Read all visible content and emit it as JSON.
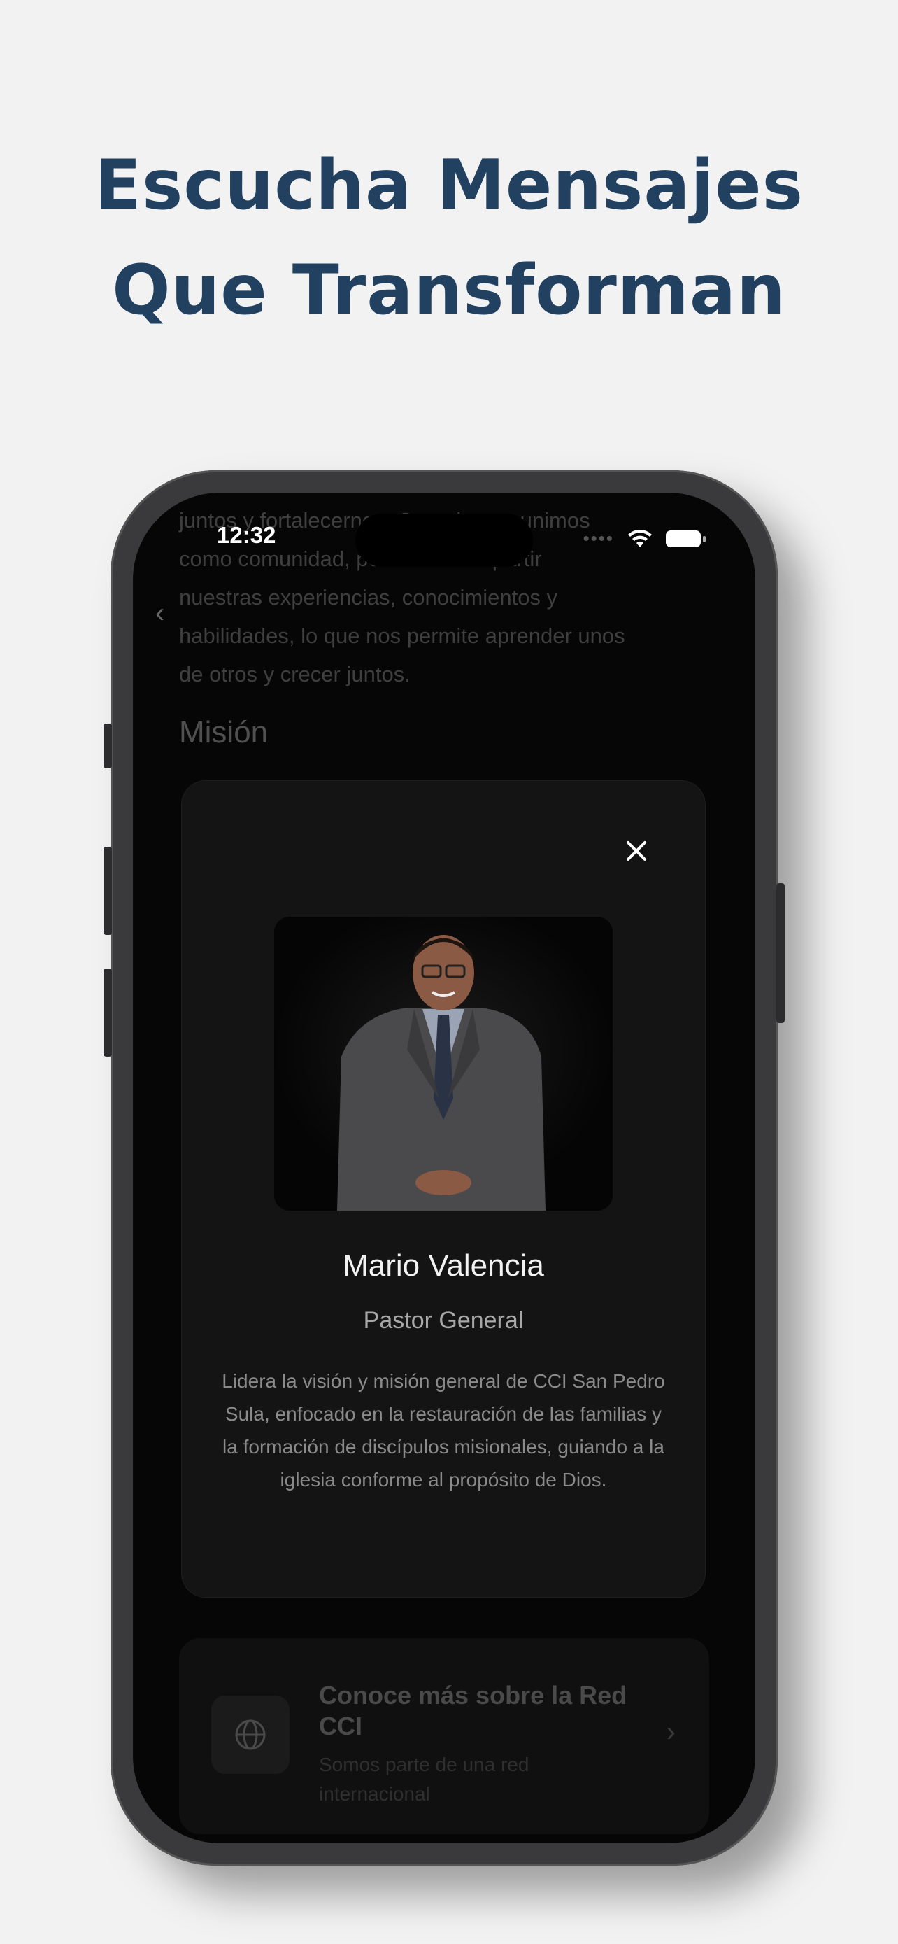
{
  "headline": {
    "line1": "Escucha Mensajes",
    "line2": "Que Transforman"
  },
  "status_bar": {
    "time": "12:32"
  },
  "background_content": {
    "paragraph_lines": [
      "juntos y fortalecernos. Cuando nos unimos",
      "como comunidad, podemos compartir",
      "nuestras experiencias, conocimientos y",
      "habilidades, lo que nos permite aprender unos",
      "de otros y crecer juntos."
    ],
    "heading": "Misión"
  },
  "modal": {
    "name": "Mario Valencia",
    "role": "Pastor General",
    "bio": "Lidera la visión y misión general de CCI San Pedro Sula, enfocado en la restauración de las familias y la formación de discípulos misionales, guiando a la iglesia conforme al propósito de Dios."
  },
  "card": {
    "title": "Conoce más sobre la Red CCI",
    "subtitle": "Somos parte de una red internacional"
  },
  "icons": [
    "back-chevron-icon",
    "wifi-icon",
    "battery-icon",
    "close-icon",
    "globe-icon",
    "chevron-right-icon"
  ],
  "colors": {
    "headline": "#22405f",
    "page_background": "#f2f2f2",
    "modal_background": "#141414"
  }
}
